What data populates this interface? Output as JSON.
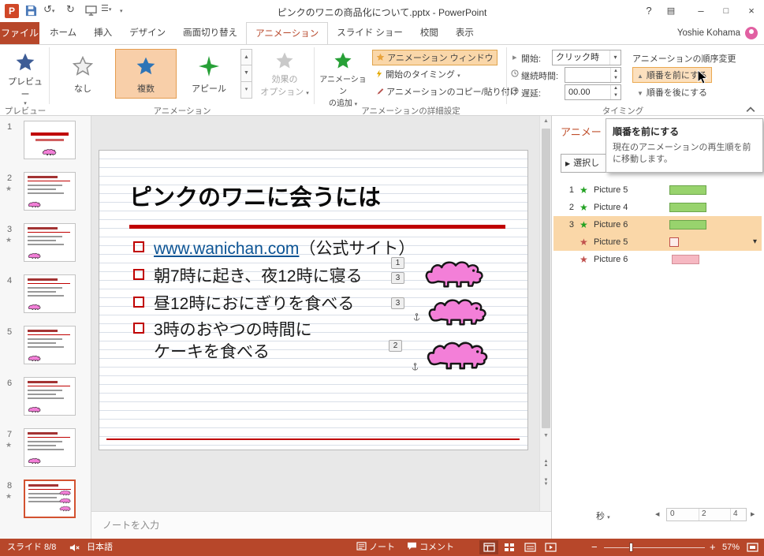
{
  "titlebar": {
    "title": "ピンクのワニの商品化について.pptx - PowerPoint",
    "app_initial": "P",
    "help_icon": "?"
  },
  "ribbon_tabs": {
    "file": "ファイル",
    "tabs": [
      "ホーム",
      "挿入",
      "デザイン",
      "画面切り替え",
      "アニメーション",
      "スライド ショー",
      "校閲",
      "表示"
    ],
    "active": "アニメーション",
    "user_name": "Yoshie Kohama"
  },
  "ribbon": {
    "preview_label": "プレビュー",
    "gallery": [
      {
        "label": "なし",
        "selected": false
      },
      {
        "label": "複数",
        "selected": true
      },
      {
        "label": "アピール",
        "selected": false
      }
    ],
    "effect_options_line1": "効果の",
    "effect_options_line2": "オプション",
    "add_animation_line1": "アニメーション",
    "add_animation_line2": "の追加",
    "animation_pane": "アニメーション ウィンドウ",
    "trigger": "開始のタイミング",
    "painter": "アニメーションのコピー/貼り付け",
    "start_label": "開始:",
    "start_value": "クリック時",
    "duration_label": "継続時間:",
    "duration_value": "",
    "delay_label": "遅延:",
    "delay_value": "00.00",
    "reorder_header": "アニメーションの順序変更",
    "move_earlier": "順番を前にする",
    "move_later": "順番を後にする",
    "groups": {
      "preview": "プレビュー",
      "animation": "アニメーション",
      "advanced": "アニメーションの詳細設定",
      "timing": "タイミング"
    }
  },
  "tooltip": {
    "title": "順番を前にする",
    "body": "現在のアニメーションの再生順を前に移動します。"
  },
  "slides": [
    {
      "num": "1",
      "starred": false,
      "variant": "title"
    },
    {
      "num": "2",
      "starred": true,
      "variant": "content"
    },
    {
      "num": "3",
      "starred": true,
      "variant": "content"
    },
    {
      "num": "4",
      "starred": false,
      "variant": "content"
    },
    {
      "num": "5",
      "starred": false,
      "variant": "content"
    },
    {
      "num": "6",
      "starred": false,
      "variant": "content"
    },
    {
      "num": "7",
      "starred": true,
      "variant": "content"
    },
    {
      "num": "8",
      "starred": true,
      "variant": "current",
      "selected": true
    }
  ],
  "slide": {
    "title": "ピンクのワニに会うには",
    "bullets": [
      {
        "link": "www.wanichan.com",
        "suffix": "（公式サイト）"
      },
      {
        "text": "朝7時に起き、夜12時に寝る"
      },
      {
        "text": "昼12時におにぎりを食べる"
      },
      {
        "text": "3時のおやつの時間に"
      },
      {
        "text": "ケーキを食べる"
      }
    ],
    "badges": [
      "1",
      "3",
      "3",
      "2"
    ]
  },
  "notes_placeholder": "ノートを入力",
  "pane": {
    "header_visible": "アニメー",
    "play_selected_visible": "選択し",
    "items": [
      {
        "order": "1",
        "type": "entrance",
        "label": "Picture 5",
        "bar": "green",
        "selected": false,
        "dropdown": false
      },
      {
        "order": "2",
        "type": "entrance",
        "label": "Picture 4",
        "bar": "green",
        "selected": false,
        "dropdown": false
      },
      {
        "order": "3",
        "type": "entrance",
        "label": "Picture 6",
        "bar": "green",
        "selected": true,
        "dropdown": false
      },
      {
        "order": "",
        "type": "exit",
        "label": "Picture 5",
        "bar": "outline",
        "selected": true,
        "dropdown": true
      },
      {
        "order": "",
        "type": "exit",
        "label": "Picture 6",
        "bar": "pink",
        "selected": false,
        "dropdown": false
      }
    ],
    "seconds_label": "秒",
    "ticks": [
      "0",
      "2",
      "4"
    ]
  },
  "statusbar": {
    "slide_info": "スライド 8/8",
    "language": "日本語",
    "notes": "ノート",
    "comments": "コメント",
    "zoom": "57%"
  },
  "colors": {
    "accent": "#B7472A",
    "selection_orange": "#FAD7A8",
    "bar_green": "#98D36D",
    "bar_pink": "#F6B8C2",
    "slide_red": "#C00000",
    "link_blue": "#0B5394",
    "croc_pink": "#F37FD8"
  }
}
